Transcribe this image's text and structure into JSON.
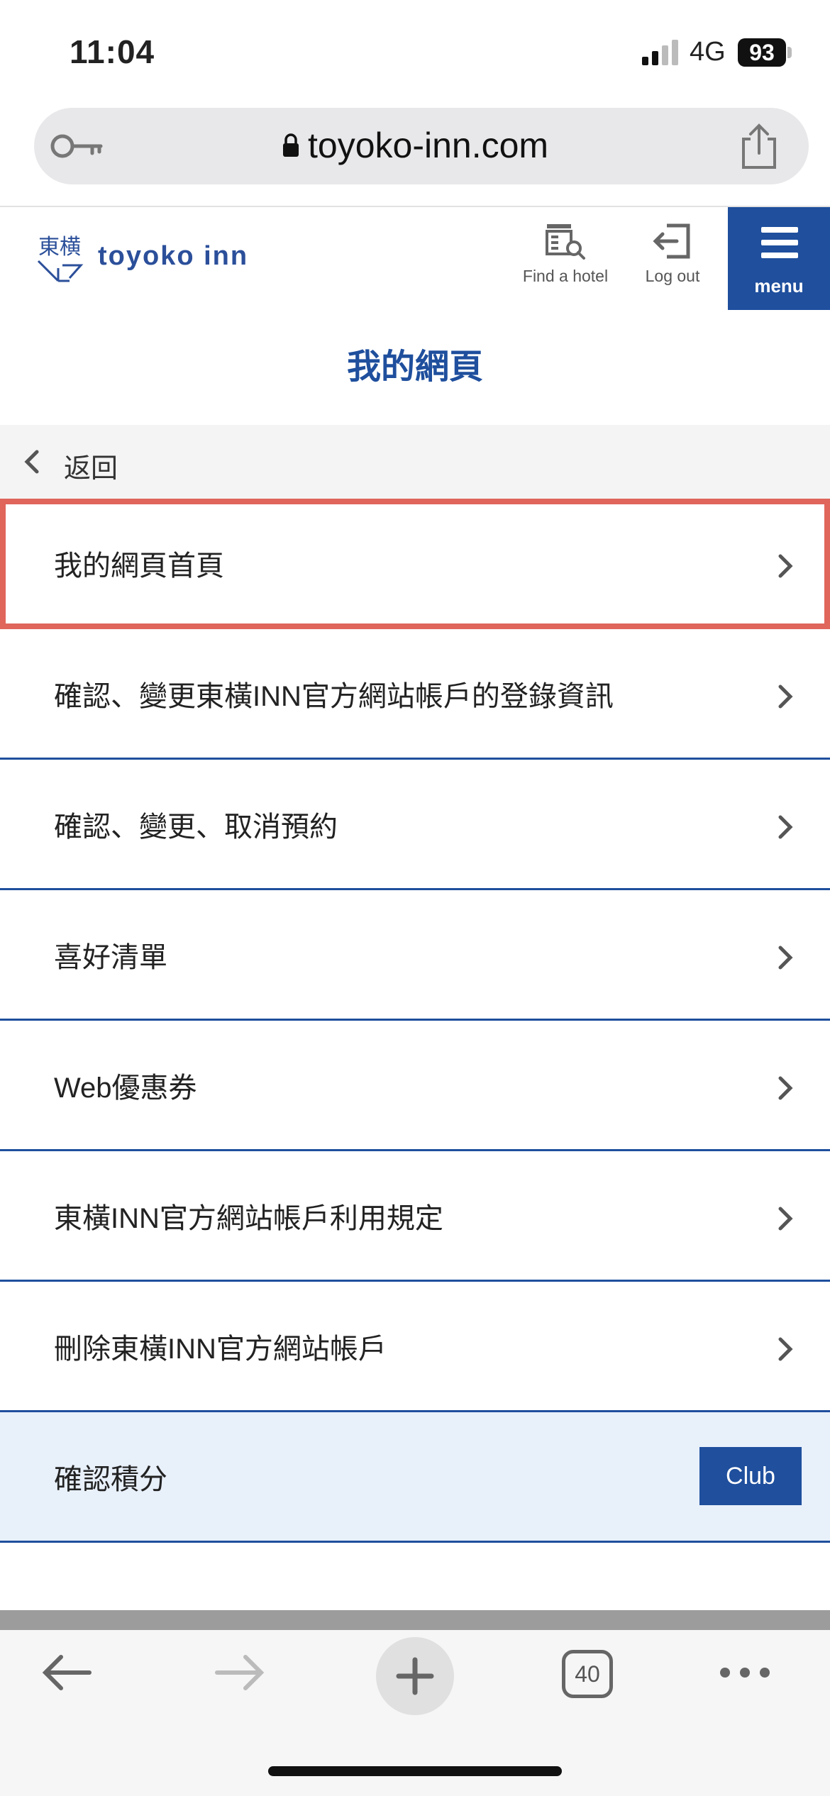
{
  "status_bar": {
    "time": "11:04",
    "network": "4G",
    "battery": "93"
  },
  "browser": {
    "url": "toyoko-inn.com",
    "tabs_count": "40"
  },
  "site_header": {
    "logo_text": "toyoko inn",
    "find_hotel_label": "Find a hotel",
    "logout_label": "Log out",
    "menu_label": "menu"
  },
  "page_title": "我的網頁",
  "back_label": "返回",
  "menu_items": [
    {
      "label": "我的網頁首頁",
      "highlighted": true
    },
    {
      "label": "確認、變更東橫INN官方網站帳戶的登錄資訊"
    },
    {
      "label": "確認、變更、取消預約"
    },
    {
      "label": "喜好清單"
    },
    {
      "label": "Web優惠券"
    },
    {
      "label": "東橫INN官方網站帳戶利用規定"
    },
    {
      "label": "刪除東橫INN官方網站帳戶"
    }
  ],
  "points_item": {
    "label": "確認積分",
    "badge": "Club"
  },
  "colors": {
    "brand_blue": "#1f4f9d",
    "highlight_red": "#e0655b",
    "points_bg": "#e8f0fa"
  }
}
